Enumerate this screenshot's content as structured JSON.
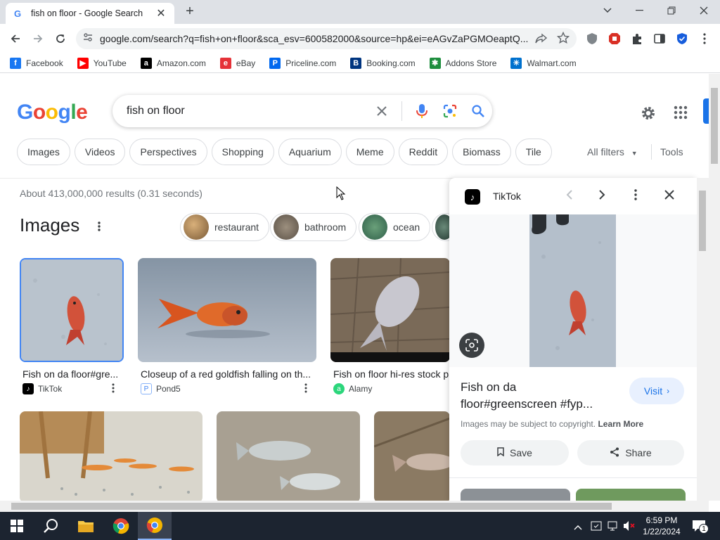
{
  "browser": {
    "tab_title": "fish on floor - Google Search",
    "url": "google.com/search?q=fish+on+floor&sca_esv=600582000&source=hp&ei=eAGvZaPGMOeaptQ...",
    "bookmarks": [
      {
        "label": "Facebook",
        "icon": "facebook-icon",
        "color": "#1877f2",
        "glyph": "f"
      },
      {
        "label": "YouTube",
        "icon": "youtube-icon",
        "color": "#ff0000",
        "glyph": "▶"
      },
      {
        "label": "Amazon.com",
        "icon": "amazon-icon",
        "color": "#000000",
        "glyph": "a"
      },
      {
        "label": "eBay",
        "icon": "ebay-icon",
        "color": "#e53238",
        "glyph": "e"
      },
      {
        "label": "Priceline.com",
        "icon": "priceline-icon",
        "color": "#0068ef",
        "glyph": "P"
      },
      {
        "label": "Booking.com",
        "icon": "booking-icon",
        "color": "#003580",
        "glyph": "B"
      },
      {
        "label": "Addons Store",
        "icon": "addons-store-icon",
        "color": "#1e8e3e",
        "glyph": "✱"
      },
      {
        "label": "Walmart.com",
        "icon": "walmart-icon",
        "color": "#0071ce",
        "glyph": "✳"
      }
    ]
  },
  "search": {
    "query": "fish on floor",
    "chips": [
      "Images",
      "Videos",
      "Perspectives",
      "Shopping",
      "Aquarium",
      "Meme",
      "Reddit",
      "Biomass",
      "Tile"
    ],
    "all_filters": "All filters",
    "tools": "Tools",
    "result_stats": "About 413,000,000 results (0.31 seconds)"
  },
  "images": {
    "heading": "Images",
    "refinements": [
      "restaurant",
      "bathroom",
      "ocean"
    ],
    "results": [
      {
        "caption": "Fish on da floor#gre...",
        "source": "TikTok"
      },
      {
        "caption": "Closeup of a red goldfish falling on th...",
        "source": "Pond5"
      },
      {
        "caption": "Fish on floor hi-res stock p",
        "source": "Alamy"
      }
    ]
  },
  "panel": {
    "source": "TikTok",
    "title": "Fish on da floor#greenscreen #fyp...",
    "visit": "Visit",
    "copyright": "Images may be subject to copyright.",
    "learn_more": "Learn More",
    "save": "Save",
    "share": "Share"
  },
  "taskbar": {
    "time": "6:59 PM",
    "date": "1/22/2024",
    "notifications": "1"
  },
  "colors": {
    "google_blue": "#4285f4",
    "google_red": "#ea4335",
    "google_yellow": "#fbbc05",
    "google_green": "#34a853",
    "selected_border": "#4285f4"
  }
}
